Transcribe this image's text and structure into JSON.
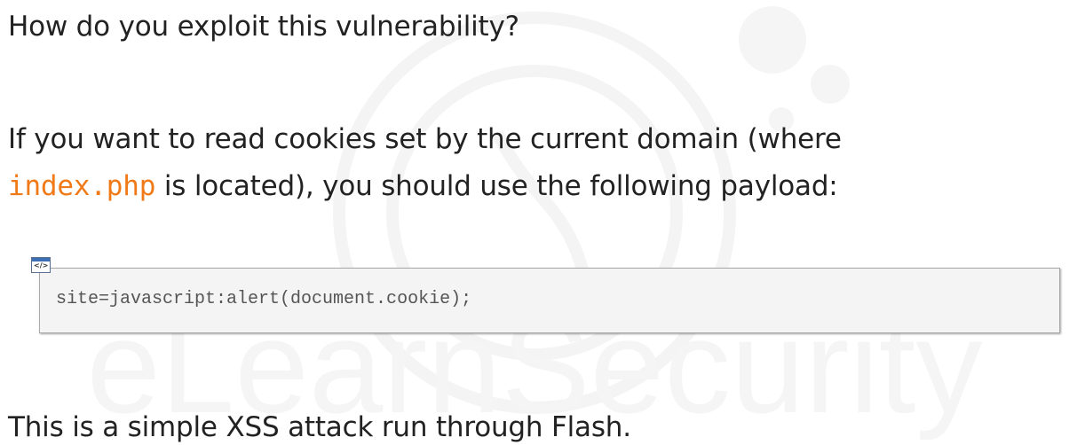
{
  "question": "How do you exploit this vulnerability?",
  "paragraph": {
    "line1": "If you want to read cookies set by the current domain (where",
    "code_term": "index.php",
    "line2_rest": " is located), you should use the following payload:"
  },
  "code_block": {
    "icon": "code-snippet-icon",
    "icon_glyph": "</>",
    "code": "site=javascript:alert(document.cookie);"
  },
  "summary": "This is a simple XSS attack run through Flash.",
  "watermark_text": "eLearnSecurity",
  "colors": {
    "text": "#222222",
    "code_highlight": "#f07a18",
    "code_background": "#f4f4f4",
    "watermark": "#f3f3f3"
  }
}
